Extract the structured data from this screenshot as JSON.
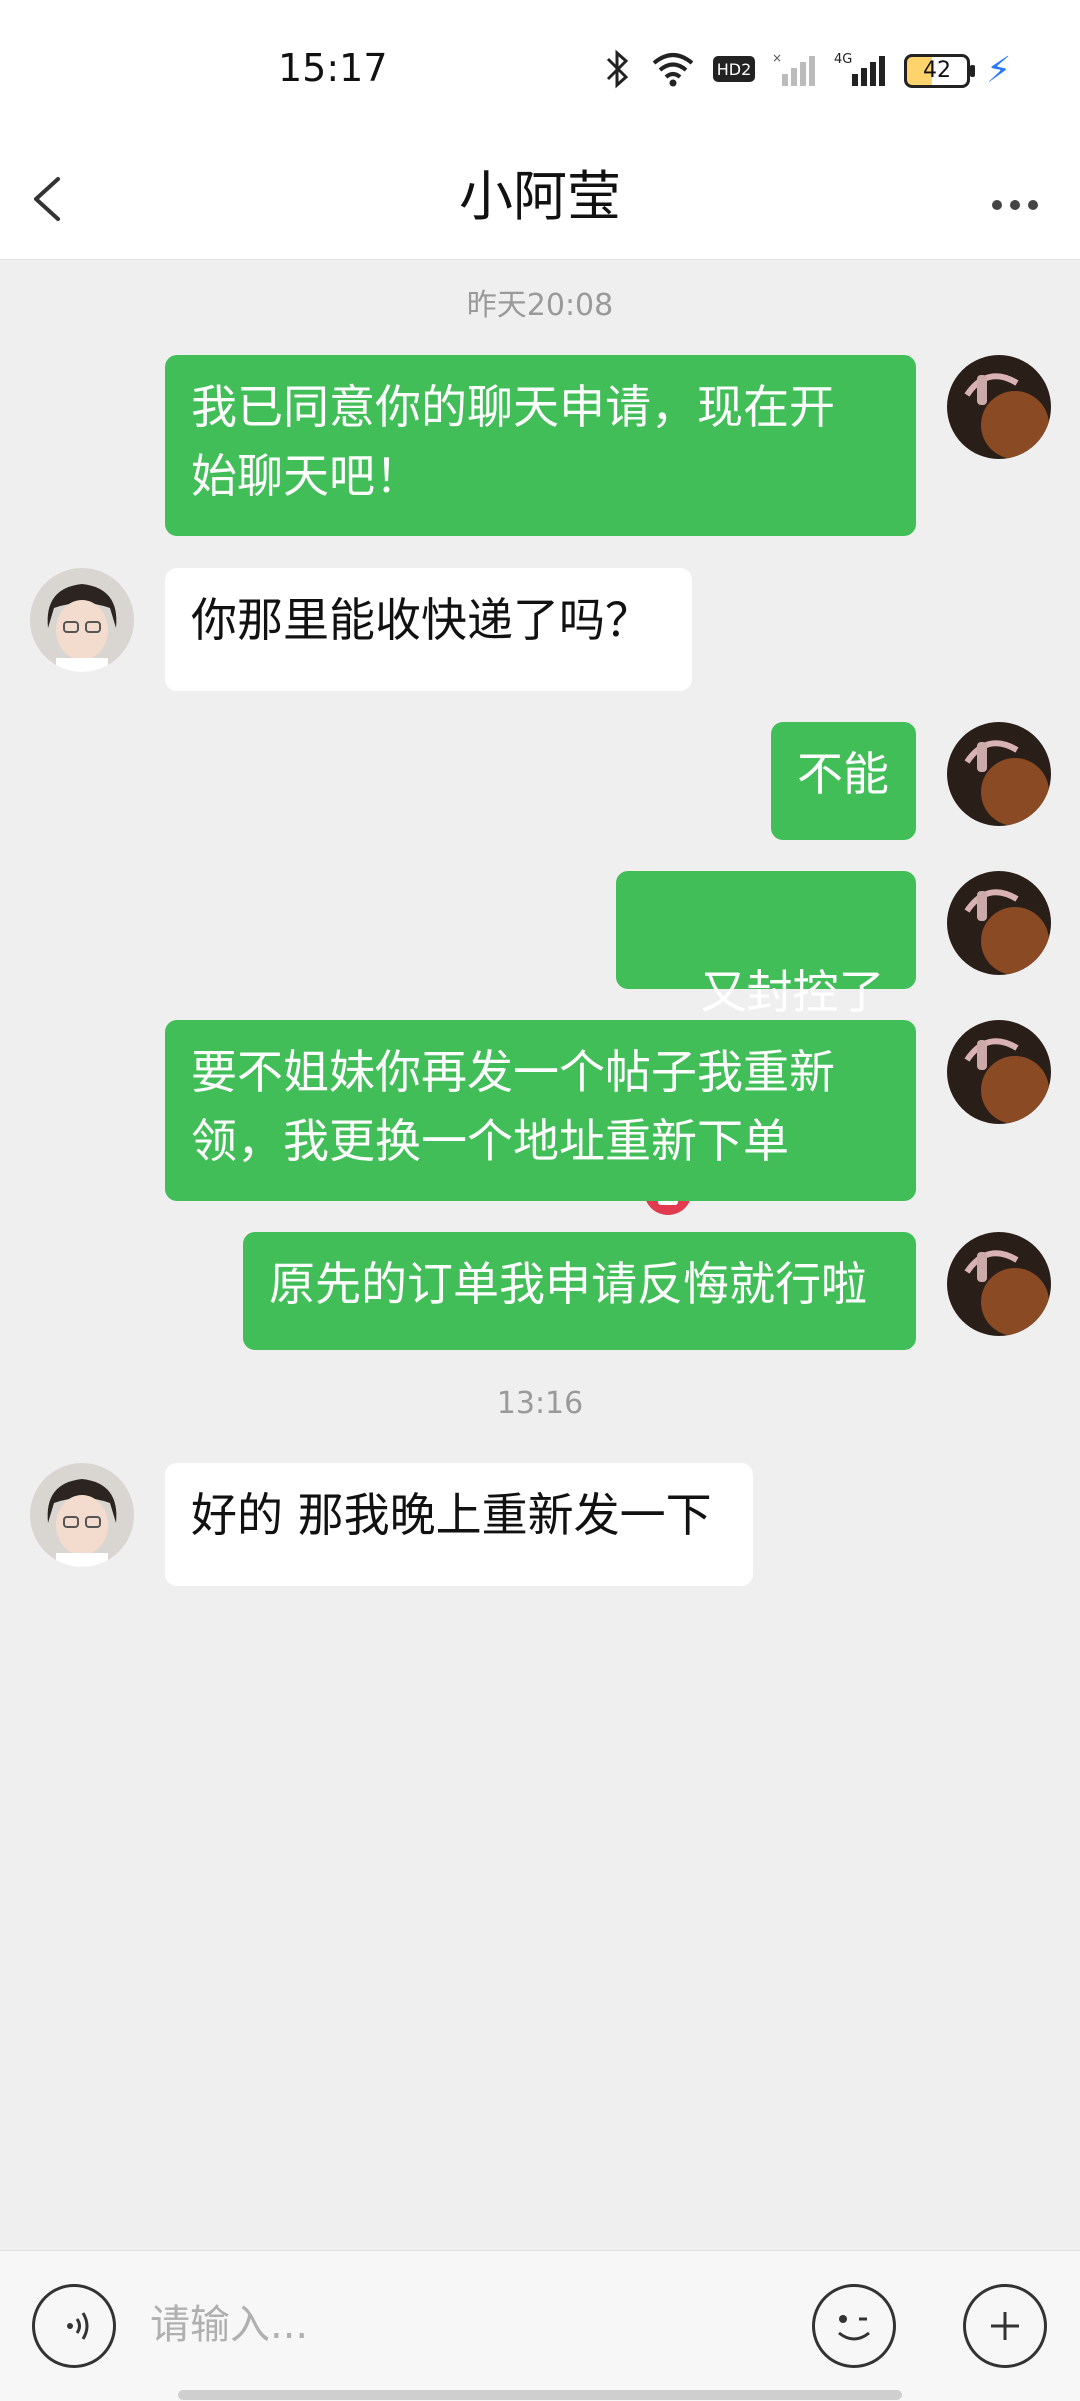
{
  "status_bar": {
    "time": "15:17",
    "battery": "42",
    "network": "4G",
    "hd_badge": "HD2"
  },
  "header": {
    "title": "小阿莹",
    "back_icon": "chevron-left-icon",
    "more_icon": "more-horizontal-icon"
  },
  "chat": {
    "timestamps": [
      "昨天20:08",
      "13:16"
    ],
    "messages": [
      {
        "from": "me",
        "text": "我已同意你的聊天申请，现在开\n始聊天吧！"
      },
      {
        "from": "other",
        "text": "你那里能收快递了吗？"
      },
      {
        "from": "me",
        "text": "不能"
      },
      {
        "from": "me",
        "text": "又封控了",
        "emoji": "angry-face-icon"
      },
      {
        "from": "me",
        "text": "要不姐妹你再发一个帖子我重新\n领，我更换一个地址重新下单"
      },
      {
        "from": "me",
        "text": "原先的订单我申请反悔就行啦"
      },
      {
        "from": "other",
        "text": "好的 那我晚上重新发一下"
      }
    ]
  },
  "input_bar": {
    "placeholder": "请输入...",
    "voice_icon": "voice-icon",
    "emoji_icon": "smile-icon",
    "add_icon": "plus-icon"
  },
  "colors": {
    "my_bubble": "#41be57",
    "other_bubble": "#ffffff",
    "background": "#efefef"
  }
}
